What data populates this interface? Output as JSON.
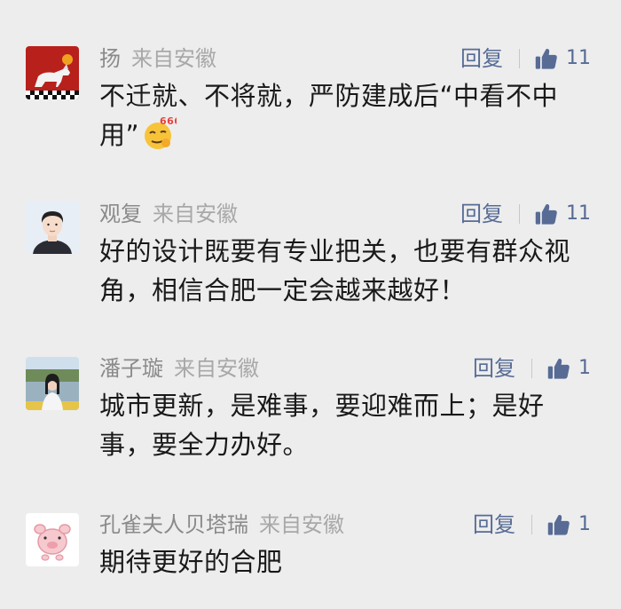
{
  "comments": [
    {
      "name": "扬",
      "location": "来自安徽",
      "reply_label": "回复",
      "likes": "11",
      "text": "不迁就、不将就，严防建成后“中看不中用”",
      "emoji": "thinking-face-666-emoji",
      "emoji_text": "666",
      "avatar": "horse-avatar"
    },
    {
      "name": "观复",
      "location": "来自安徽",
      "reply_label": "回复",
      "likes": "11",
      "text": "好的设计既要有专业把关，也要有群众视角，相信合肥一定会越来越好！",
      "avatar": "cartoon-man-avatar"
    },
    {
      "name": "潘子璇",
      "location": "来自安徽",
      "reply_label": "回复",
      "likes": "1",
      "text": "城市更新，是难事，要迎难而上；是好事，要全力办好。",
      "avatar": "girl-by-lake-avatar"
    },
    {
      "name": "孔雀夫人贝塔瑞",
      "location": "来自安徽",
      "reply_label": "回复",
      "likes": "1",
      "text": "期待更好的合肥",
      "avatar": "pink-pig-avatar"
    }
  ],
  "colors": {
    "background": "#ededed",
    "link": "#576b95",
    "name": "#8a8a8a",
    "text": "#191919"
  }
}
